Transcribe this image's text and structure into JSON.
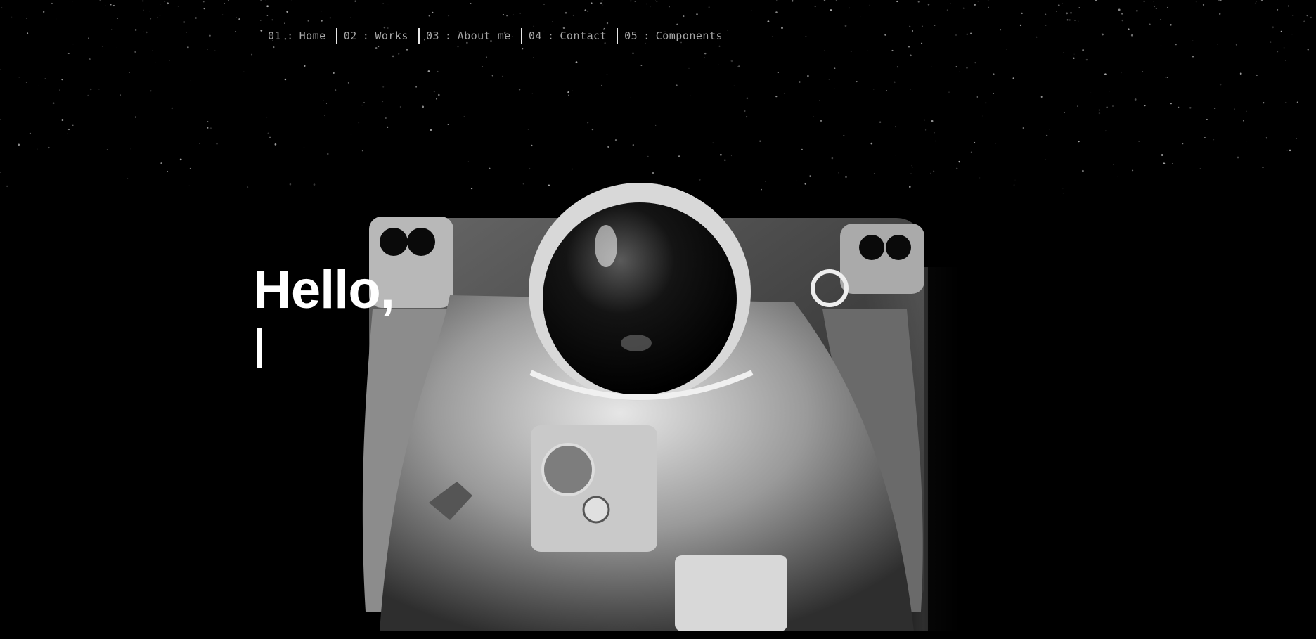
{
  "nav": {
    "items": [
      {
        "num": "01",
        "label": "Home"
      },
      {
        "num": "02",
        "label": "Works"
      },
      {
        "num": "03",
        "label": "About me"
      },
      {
        "num": "04",
        "label": "Contact"
      },
      {
        "num": "05",
        "label": "Components"
      }
    ],
    "separator": ":"
  },
  "hero": {
    "title": "Hello,",
    "background": "astronaut-in-space-photo"
  },
  "colors": {
    "background": "#000000",
    "nav_text": "#a8a8a8",
    "title": "#ffffff"
  }
}
